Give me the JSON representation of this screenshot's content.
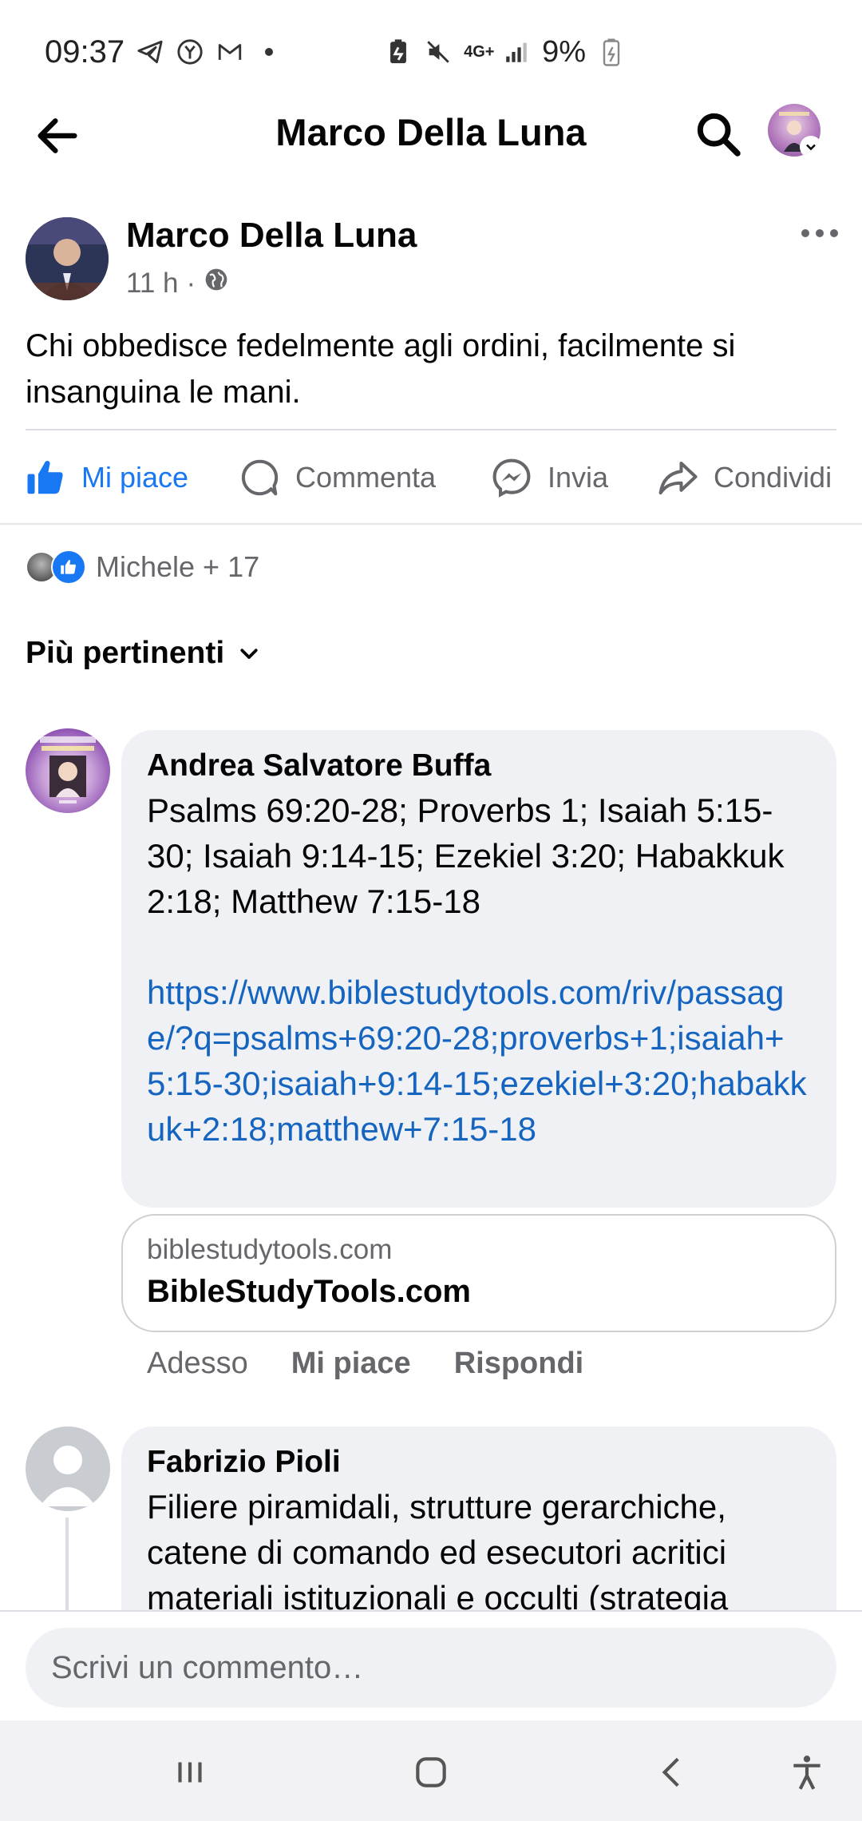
{
  "status_bar": {
    "time": "09:37",
    "network": "4G+",
    "battery": "9%",
    "icons": [
      "telegram-icon",
      "yahoo-icon",
      "gmail-icon",
      "notification-dot-icon",
      "battery-saver-icon",
      "mute-icon",
      "signal-icon",
      "battery-icon"
    ]
  },
  "header": {
    "title": "Marco Della Luna",
    "icons": [
      "back-arrow-icon",
      "search-icon",
      "profile-avatar",
      "chevron-down-icon"
    ]
  },
  "post": {
    "author": "Marco Della Luna",
    "time": "11 h",
    "separator": "·",
    "privacy_icon": "globe-icon",
    "text": "Chi obbedisce fedelmente agli ordini, facilmente si insanguina le mani."
  },
  "actions": {
    "like": "Mi piace",
    "comment": "Commenta",
    "send": "Invia",
    "share": "Condividi"
  },
  "reactions": {
    "summary": "Michele + 17"
  },
  "sort": {
    "label": "Più pertinenti"
  },
  "comments": [
    {
      "author": "Andrea Salvatore Buffa",
      "text": "Psalms 69:20-28; Proverbs 1; Isaiah 5:15-30; Isaiah 9:14-15; Ezekiel 3:20; Habakkuk 2:18; Matthew 7:15-18",
      "link": "https://www.biblestudytools.com/riv/passage/?q=psalms+69:20-28;proverbs+1;isaiah+5:15-30;isaiah+9:14-15;ezekiel+3:20;habakkuk+2:18;matthew+7:15-18",
      "preview": {
        "domain": "biblestudytools.com",
        "title": "BibleStudyTools.com"
      },
      "time": "Adesso",
      "like": "Mi piace",
      "reply": "Rispondi"
    },
    {
      "author": "Fabrizio Pioli",
      "text": "Filiere piramidali, strutture gerarchiche, catene di comando ed esecutori acritici materiali istituzionali e occulti (strategia"
    }
  ],
  "composer": {
    "placeholder": "Scrivi un commento…"
  },
  "colors": {
    "accent": "#1877f2",
    "link": "#1565c0",
    "bubble": "#eff1f5",
    "muted": "#65676b"
  }
}
